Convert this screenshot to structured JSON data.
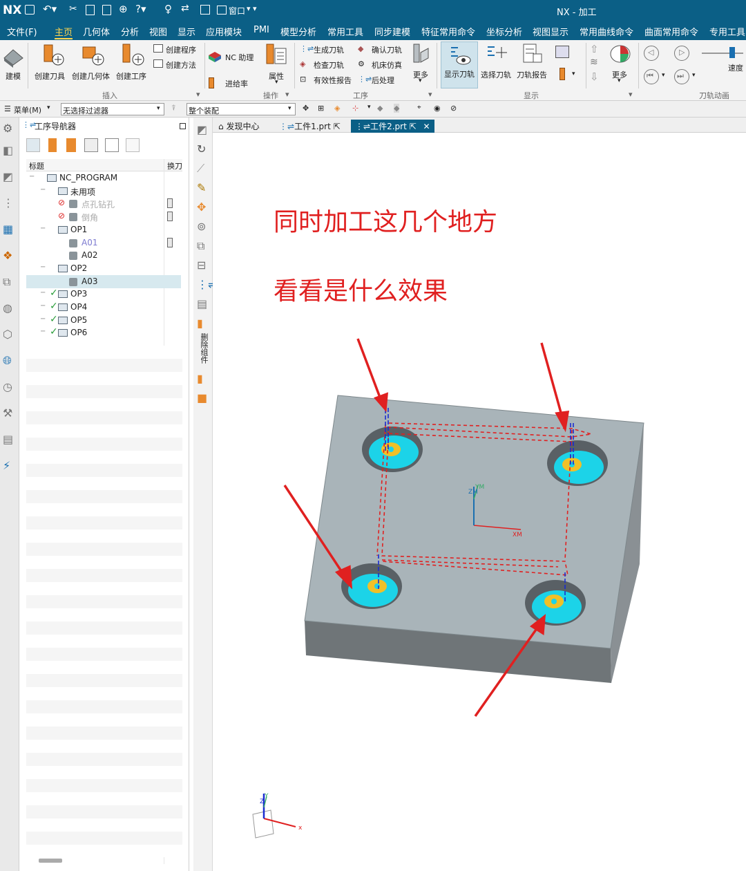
{
  "app": {
    "logo": "NX",
    "window_title": "NX - 加工",
    "window_menu": "窗口"
  },
  "menu": [
    "文件(F)",
    "主页",
    "几何体",
    "分析",
    "视图",
    "显示",
    "应用模块",
    "PMI",
    "模型分析",
    "常用工具",
    "同步建模",
    "特征常用命令",
    "坐标分析",
    "视图显示",
    "常用曲线命令",
    "曲面常用命令",
    "专用工具"
  ],
  "ribbon": {
    "build": "建模",
    "create_tool": "创建刀具",
    "create_geometry": "创建几何体",
    "create_operation": "创建工序",
    "create_program": "创建程序",
    "create_method": "创建方法",
    "nc_assistant": "NC 助理",
    "feed_rate": "进给率",
    "properties": "属性",
    "gen_path": "生成刀轨",
    "verify_path": "确认刀轨",
    "check_path": "检查刀轨",
    "machine_sim": "机床仿真",
    "validity_report": "有效性报告",
    "post_process": "后处理",
    "more": "更多",
    "show_path": "显示刀轨",
    "select_path": "选择刀轨",
    "path_report": "刀轨报告",
    "more2": "更多",
    "speed": "速度",
    "groups": {
      "insert": "插入",
      "operation": "操作",
      "process": "工序",
      "display": "显示",
      "animation": "刀轨动画"
    }
  },
  "selection_bar": {
    "menu": "菜单(M)",
    "filter": "无选择过滤器",
    "assembly": "整个装配"
  },
  "navigator": {
    "title": "工序导航器",
    "col_title": "标题",
    "col_tool_change": "换刀",
    "rows": [
      {
        "label": "NC_PROGRAM",
        "indent": 0,
        "status": "",
        "kind": "folder"
      },
      {
        "label": "未用项",
        "indent": 1,
        "status": "",
        "kind": "folder"
      },
      {
        "label": "点孔钻孔",
        "indent": 2,
        "status": "none",
        "kind": "op",
        "dim": true
      },
      {
        "label": "倒角",
        "indent": 2,
        "status": "none",
        "kind": "op",
        "dim": true
      },
      {
        "label": "OP1",
        "indent": 1,
        "status": "",
        "kind": "folder"
      },
      {
        "label": "A01",
        "indent": 2,
        "status": "",
        "kind": "op",
        "dim": true
      },
      {
        "label": "A02",
        "indent": 2,
        "status": "",
        "kind": "op"
      },
      {
        "label": "OP2",
        "indent": 1,
        "status": "",
        "kind": "folder"
      },
      {
        "label": "A03",
        "indent": 2,
        "status": "",
        "kind": "op",
        "selected": true
      },
      {
        "label": "OP3",
        "indent": 1,
        "status": "ok",
        "kind": "folder"
      },
      {
        "label": "OP4",
        "indent": 1,
        "status": "ok",
        "kind": "folder"
      },
      {
        "label": "OP5",
        "indent": 1,
        "status": "ok",
        "kind": "folder"
      },
      {
        "label": "OP6",
        "indent": 1,
        "status": "ok",
        "kind": "folder"
      }
    ]
  },
  "tabs": [
    "发现中心",
    "工件1.prt",
    "工件2.prt"
  ],
  "side_tool_label": "删除组件",
  "annotation": {
    "line1": "同时加工这几个地方",
    "line2": "看看是什么效果",
    "color": "#e02020"
  },
  "axes": {
    "xm": "XM",
    "ym": "YM",
    "zm": "ZM",
    "x": "x",
    "y": "Y",
    "z": "Z"
  },
  "colors": {
    "titlebar": "#0b5f86",
    "part": "#a9b4b9",
    "part_side": "#6f7578",
    "hole": "#1cd3e8",
    "toolpath": "#e02020"
  }
}
